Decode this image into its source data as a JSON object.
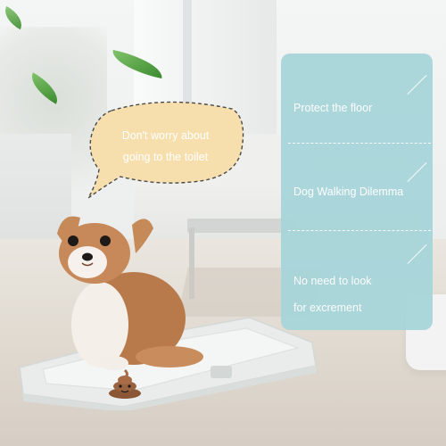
{
  "bubble": {
    "line1": "Don't worry about",
    "line2": "going to the toilet"
  },
  "panel": {
    "items": [
      {
        "lines": [
          "Protect the floor"
        ]
      },
      {
        "lines": [
          "Dog Walking Dilemma"
        ]
      },
      {
        "lines": [
          "No need to look",
          "for excrement"
        ]
      }
    ]
  },
  "colors": {
    "panel": "#a6d5da",
    "bubble": "#f7dfad",
    "tray": "#e9eceb",
    "leaf": "#4b9a3a"
  }
}
